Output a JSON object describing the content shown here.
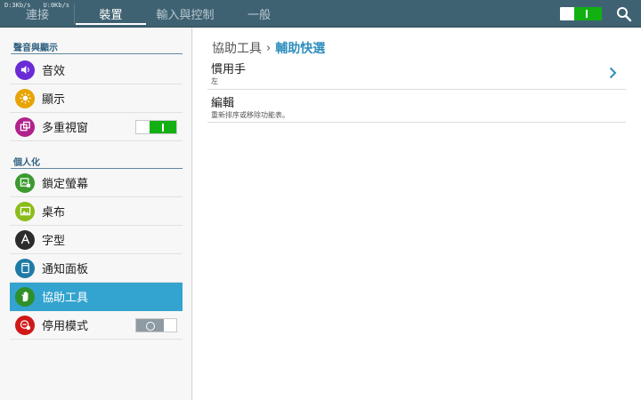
{
  "status": {
    "download_speed": "D:3Kb/s",
    "upload_speed": "U:0Kb/s"
  },
  "tabs": [
    {
      "label": "連接",
      "active": false
    },
    {
      "label": "裝置",
      "active": true
    },
    {
      "label": "輸入與控制",
      "active": false
    },
    {
      "label": "一般",
      "active": false
    }
  ],
  "topbar": {
    "master_toggle_on": true,
    "search_icon": "search-icon"
  },
  "sidebar": {
    "sections": [
      {
        "header": "聲音與顯示",
        "items": [
          {
            "label": "音效",
            "icon": "speaker-icon",
            "color": "#6a2bd6",
            "toggle": null,
            "selected": false
          },
          {
            "label": "顯示",
            "icon": "brightness-icon",
            "color": "#e8a400",
            "toggle": null,
            "selected": false
          },
          {
            "label": "多重視窗",
            "icon": "multi-window-icon",
            "color": "#b0228a",
            "toggle": "on",
            "selected": false
          }
        ]
      },
      {
        "header": "個人化",
        "items": [
          {
            "label": "鎖定螢幕",
            "icon": "lock-screen-icon",
            "color": "#3c9a2e",
            "toggle": null,
            "selected": false
          },
          {
            "label": "桌布",
            "icon": "wallpaper-icon",
            "color": "#8cbc1a",
            "toggle": null,
            "selected": false
          },
          {
            "label": "字型",
            "icon": "font-icon",
            "color": "#2b2b2b",
            "toggle": null,
            "selected": false
          },
          {
            "label": "通知面板",
            "icon": "notification-panel-icon",
            "color": "#1f7aa6",
            "toggle": null,
            "selected": false
          },
          {
            "label": "協助工具",
            "icon": "hand-icon",
            "color": "#2f8f2a",
            "toggle": null,
            "selected": true
          },
          {
            "label": "停用模式",
            "icon": "blocking-mode-icon",
            "color": "#d01818",
            "toggle": "off",
            "selected": false
          }
        ]
      }
    ]
  },
  "main": {
    "breadcrumb": {
      "parent": "協助工具",
      "separator": "›",
      "current": "輔助快選"
    },
    "rows": [
      {
        "title": "慣用手",
        "subtitle": "左",
        "has_chevron": true
      },
      {
        "title": "編輯",
        "subtitle": "重新排序或移除功能表。",
        "has_chevron": false
      }
    ]
  },
  "colors": {
    "topbar": "#3f6272",
    "accent": "#33a3cf",
    "toggle_on": "#13b013",
    "breadcrumb_current": "#2f8fbd"
  }
}
